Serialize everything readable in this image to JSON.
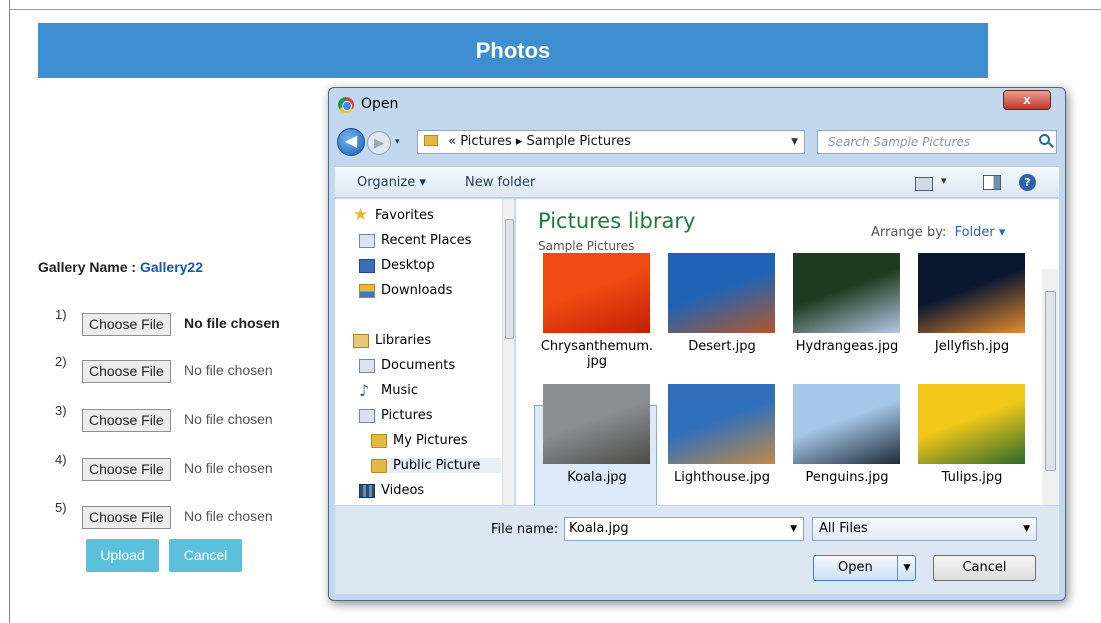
{
  "page": {
    "banner_title": "Photos"
  },
  "gallery": {
    "label": "Gallery Name :",
    "name": "Gallery22"
  },
  "uploads": [
    {
      "num": "1)",
      "button": "Choose File",
      "status": "No file chosen"
    },
    {
      "num": "2)",
      "button": "Choose File",
      "status": "No file chosen"
    },
    {
      "num": "3)",
      "button": "Choose File",
      "status": "No file chosen"
    },
    {
      "num": "4)",
      "button": "Choose File",
      "status": "No file chosen"
    },
    {
      "num": "5)",
      "button": "Choose File",
      "status": "No file chosen"
    }
  ],
  "actions": {
    "upload": "Upload",
    "cancel": "Cancel"
  },
  "dialog": {
    "title": "Open",
    "close_glyph": "x",
    "address": {
      "prefix": "«",
      "crumb1": "Pictures",
      "sep": "▸",
      "crumb2": "Sample Pictures"
    },
    "search_placeholder": "Search Sample Pictures",
    "toolbar": {
      "organize": "Organize ▾",
      "new_folder": "New folder",
      "help": "?"
    },
    "nav": [
      {
        "label": "Favorites",
        "icon": "star-icon"
      },
      {
        "label": "Recent Places",
        "icon": "recent-places-icon"
      },
      {
        "label": "Desktop",
        "icon": "desktop-icon"
      },
      {
        "label": "Downloads",
        "icon": "downloads-icon"
      },
      {
        "label": "Libraries",
        "icon": "libraries-icon"
      },
      {
        "label": "Documents",
        "icon": "documents-icon"
      },
      {
        "label": "Music",
        "icon": "music-icon"
      },
      {
        "label": "Pictures",
        "icon": "pictures-icon"
      },
      {
        "label": "My Pictures",
        "icon": "folder-icon"
      },
      {
        "label": "Public Picture",
        "icon": "folder-icon"
      },
      {
        "label": "Videos",
        "icon": "videos-icon"
      }
    ],
    "library_title": "Pictures library",
    "library_subtitle": "Sample Pictures",
    "arrange_label": "Arrange by:",
    "arrange_value": "Folder ▾",
    "files": [
      {
        "name": "Chrysanthemum.\njpg",
        "colors": [
          "#f04a12",
          "#c21f05"
        ]
      },
      {
        "name": "Desert.jpg",
        "colors": [
          "#1f63b6",
          "#b2572a"
        ]
      },
      {
        "name": "Hydrangeas.jpg",
        "colors": [
          "#1d3b1e",
          "#b6c8e6"
        ]
      },
      {
        "name": "Jellyfish.jpg",
        "colors": [
          "#0a1730",
          "#e88a2c"
        ]
      },
      {
        "name": "Koala.jpg",
        "colors": [
          "#8a8f94",
          "#4b4a45"
        ]
      },
      {
        "name": "Lighthouse.jpg",
        "colors": [
          "#2f6fbb",
          "#c08a48"
        ]
      },
      {
        "name": "Penguins.jpg",
        "colors": [
          "#a5c8e8",
          "#1e2a3a"
        ]
      },
      {
        "name": "Tulips.jpg",
        "colors": [
          "#f2c81a",
          "#2c6a2a"
        ]
      }
    ],
    "file_name_label": "File name:",
    "file_name_value": "Koala.jpg",
    "file_type": "All Files",
    "open_button": "Open",
    "cancel_button": "Cancel"
  }
}
